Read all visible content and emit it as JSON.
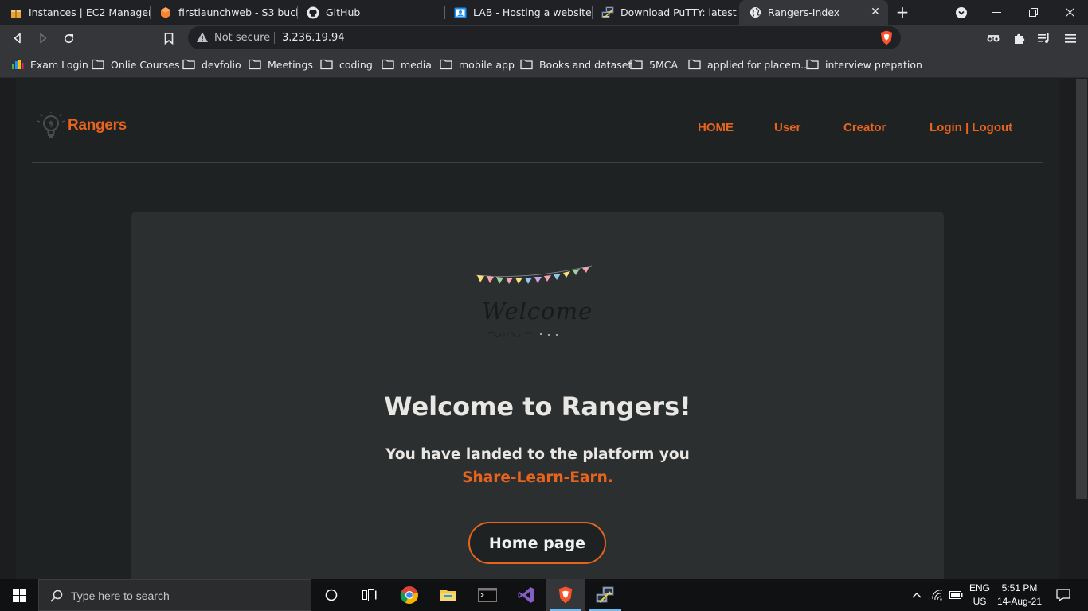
{
  "browser": {
    "tabs": [
      {
        "title": "Instances | EC2 Managemen",
        "icon": "aws-icon"
      },
      {
        "title": "firstlaunchweb - S3 bucket",
        "icon": "aws-s3-icon"
      },
      {
        "title": "GitHub",
        "icon": "github-icon"
      },
      {
        "title": "LAB - Hosting a website usir",
        "icon": "classroom-icon"
      },
      {
        "title": "Download PuTTY: latest rele",
        "icon": "putty-icon"
      },
      {
        "title": "Rangers-Index",
        "icon": "globe-icon",
        "active": true
      }
    ],
    "address": {
      "security_label": "Not secure",
      "url": "3.236.19.94"
    },
    "bookmarks": [
      "Exam Login",
      "Onlie Courses",
      "devfolio",
      "Meetings",
      "coding",
      "media",
      "mobile app",
      "Books and dataset",
      "5MCA",
      "applied for placem...",
      "interview prepation"
    ]
  },
  "site": {
    "logo_text": "Rangers",
    "nav": [
      "HOME",
      "User",
      "Creator",
      "Login | Logout"
    ],
    "hero": {
      "art_title": "Welcome",
      "title": "Welcome to Rangers!",
      "line1": "You have landed to the platform you",
      "line2": "Share-Learn-Earn.",
      "button": "Home page"
    }
  },
  "taskbar": {
    "search_placeholder": "Type here to search",
    "language_line1": "ENG",
    "language_line2": "US",
    "time": "5:51 PM",
    "date": "14-Aug-21"
  },
  "colors": {
    "accent": "#e8631c",
    "page_bg": "#1f2223",
    "card_bg": "#2c2f30",
    "text": "#e9e7e3"
  }
}
